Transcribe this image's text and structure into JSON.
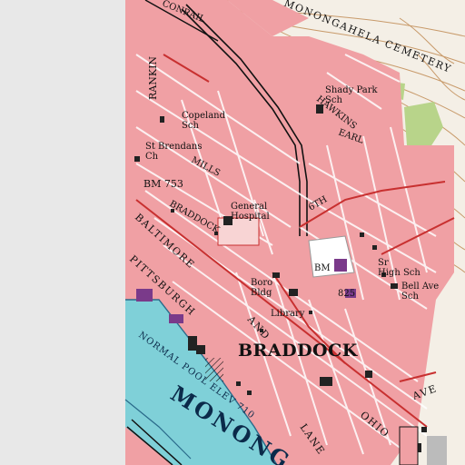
{
  "map": {
    "labels": {
      "monongahela_cemetery": "MONONGAHELA CEMETERY",
      "conrail": "CONRAIL",
      "rankin": "RANKIN",
      "shady_park_sch": "Shady Park\nSch",
      "hawkins": "HAWKINS",
      "earl": "EARL",
      "copeland_sch": "Copeland\nSch",
      "st_brendans_ch": "St Brendans\nCh",
      "mills": "MILLS",
      "bm_753": "BM 753",
      "general_hospital": "General\nHospital",
      "braddock_ave": "BRADDOCK",
      "sixth": "6TH",
      "baltimore": "BALTIMORE",
      "pittsburgh": "PITTSBURGH",
      "bm": "BM",
      "sr_high_sch": "Sr\nHigh Sch",
      "bell_ave_sch": "Bell Ave\nSch",
      "boro_bldg": "Boro\nBldg",
      "bm_825": "825",
      "library": "Library",
      "braddock": "BRADDOCK",
      "normal_pool": "NORMAL POOL ELEV 710",
      "monongahela_river": "MONONG",
      "ohio": "OHIO",
      "lane": "LANE",
      "and": "AND",
      "ave": "AVE"
    },
    "colors": {
      "urban": "#f0a0a4",
      "urban_dark": "#e8868c",
      "terrain": "#f4efe6",
      "contour": "#c89a6a",
      "water": "#7fd0d8",
      "road": "#c83030",
      "rail": "#111111",
      "building": "#222222",
      "vegetation": "#b8d48a",
      "purple": "#7a3a8a",
      "margin": "#e8e8e8"
    }
  }
}
